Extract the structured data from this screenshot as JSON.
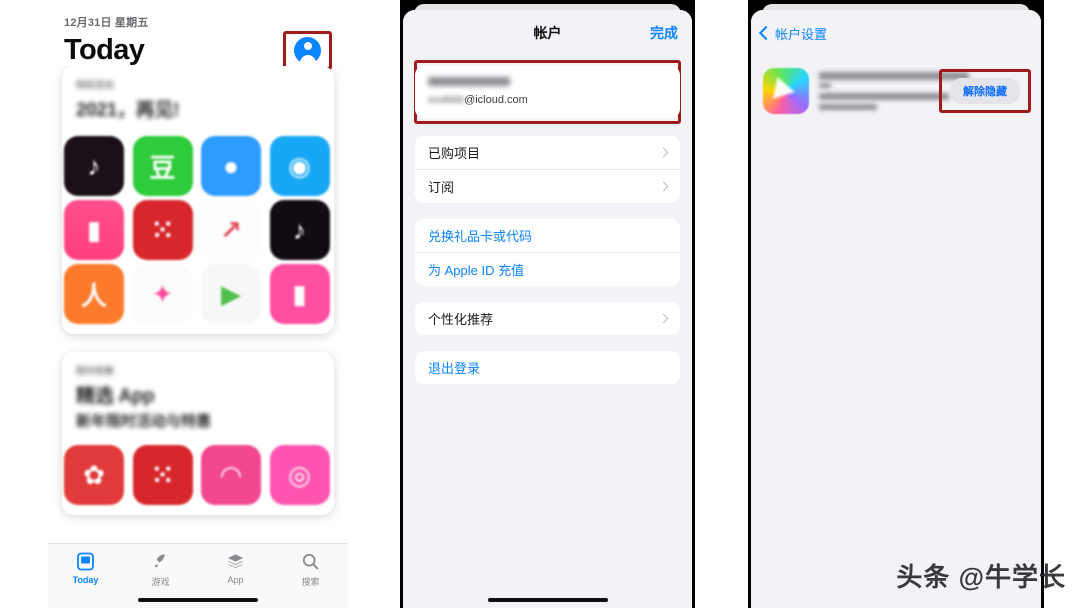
{
  "panel1": {
    "date": "12月31日 星期五",
    "title": "Today",
    "avatar_icon": "account-avatar-icon",
    "cards": [
      {
        "kicker": "特别活动",
        "headline": "2021，再见!",
        "subhead": "",
        "apps": [
          {
            "name": "douyin",
            "color": "#1b1018",
            "glyph": "♪"
          },
          {
            "name": "green-app",
            "color": "#2ecb3a",
            "glyph": "豆"
          },
          {
            "name": "blue-app",
            "color": "#2e9bff",
            "glyph": ""
          },
          {
            "name": "lightblue-app",
            "color": "#17a7f5",
            "glyph": "◉"
          },
          {
            "name": "pink-app",
            "color": "#ff4f8b",
            "glyph": ""
          },
          {
            "name": "red-dots-app",
            "color": "#d8272c",
            "glyph": "⁙"
          },
          {
            "name": "white-arrow-app",
            "color": "#fdfdfd",
            "glyph": "↗"
          },
          {
            "name": "douyin-2",
            "color": "#120c12",
            "glyph": "♪"
          },
          {
            "name": "orange-app",
            "color": "#fb7a2b",
            "glyph": "人"
          },
          {
            "name": "white-ribbon-app",
            "color": "#fbfbfb",
            "glyph": "✦"
          },
          {
            "name": "dark-play-app",
            "color": "#f7f7f7",
            "glyph": "▶"
          },
          {
            "name": "pink-app-2",
            "color": "#ff4fa0",
            "glyph": ""
          }
        ]
      },
      {
        "kicker": "限时特惠",
        "headline": "精选 App",
        "subhead": "新年限时活动与特惠",
        "apps": [
          {
            "name": "red-app-1",
            "color": "#e23a3a",
            "glyph": "✿"
          },
          {
            "name": "red-dots-app-2",
            "color": "#d8272c",
            "glyph": "⁙"
          },
          {
            "name": "pink-app-3",
            "color": "#f0478f",
            "glyph": "◠"
          },
          {
            "name": "pink-circle-app",
            "color": "#ff55b0",
            "glyph": "◎"
          }
        ]
      }
    ],
    "tabs": [
      {
        "label": "Today",
        "icon": "today-card-icon",
        "active": true
      },
      {
        "label": "游戏",
        "icon": "rocket-icon",
        "active": false
      },
      {
        "label": "App",
        "icon": "layers-icon",
        "active": false
      },
      {
        "label": "搜索",
        "icon": "search-icon",
        "active": false
      }
    ]
  },
  "panel2": {
    "nav_title": "帐户",
    "done_label": "完成",
    "account": {
      "name_redacted": "",
      "email_prefix": "",
      "email_suffix": "@icloud.com"
    },
    "group1": [
      {
        "label": "已购项目",
        "chevron": true
      },
      {
        "label": "订阅",
        "chevron": true
      }
    ],
    "group2": [
      {
        "label": "兑换礼品卡或代码",
        "link": true
      },
      {
        "label": "为 Apple ID 充值",
        "link": true
      }
    ],
    "group3": [
      {
        "label": "个性化推荐",
        "chevron": true
      }
    ],
    "group4": [
      {
        "label": "退出登录",
        "link": true
      }
    ]
  },
  "panel3": {
    "back_label": "帐户设置",
    "app": {
      "title_redacted": "",
      "developer_redacted": "",
      "size_redacted": "",
      "icon": "rainbow-app-icon"
    },
    "unhide_label": "解除隐藏"
  },
  "watermark": "头条 @牛学长",
  "colors": {
    "ios_blue": "#0a84ff",
    "highlight_red": "#a01a1a",
    "sheet_bg": "#f2f2f7"
  }
}
